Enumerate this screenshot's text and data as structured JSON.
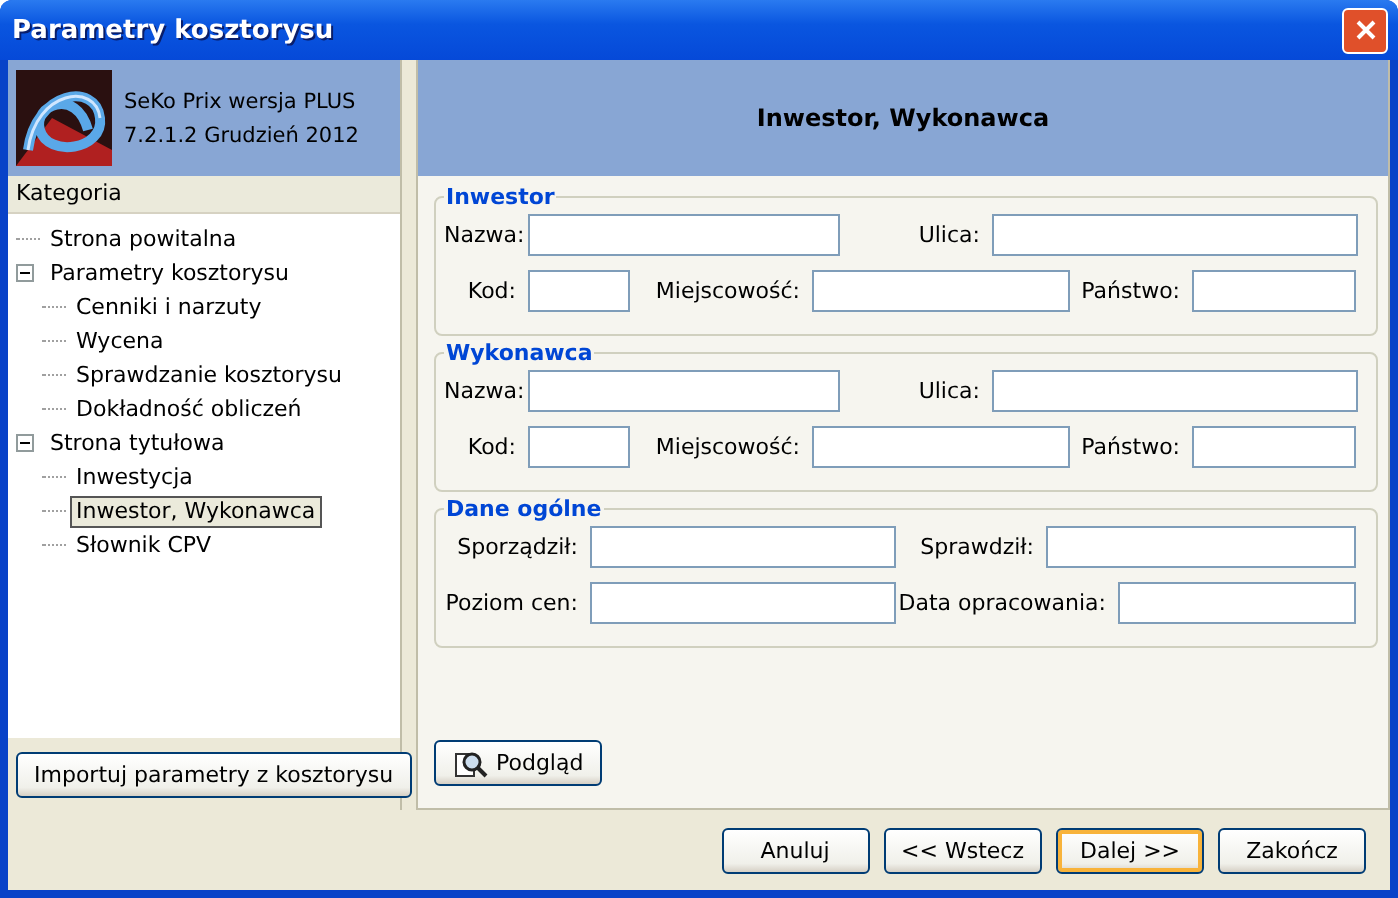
{
  "window": {
    "title": "Parametry kosztorysu"
  },
  "app_info": {
    "name": "SeKo Prix wersja PLUS",
    "version": "7.2.1.2 Grudzień 2012"
  },
  "tree": {
    "header": "Kategoria",
    "items": [
      {
        "label": "Strona powitalna",
        "selected": false
      },
      {
        "label": "Parametry kosztorysu",
        "selected": false,
        "expanded": true,
        "children": [
          {
            "label": "Cenniki i narzuty",
            "selected": false
          },
          {
            "label": "Wycena",
            "selected": false
          },
          {
            "label": "Sprawdzanie kosztorysu",
            "selected": false
          },
          {
            "label": "Dokładność obliczeń",
            "selected": false
          }
        ]
      },
      {
        "label": "Strona tytułowa",
        "selected": false,
        "expanded": true,
        "children": [
          {
            "label": "Inwestycja",
            "selected": false
          },
          {
            "label": "Inwestor, Wykonawca",
            "selected": true
          },
          {
            "label": "Słownik CPV",
            "selected": false
          }
        ]
      }
    ]
  },
  "import_button": "Importuj parametry z kosztorysu",
  "page_title": "Inwestor, Wykonawca",
  "groups": [
    {
      "title": "Inwestor",
      "kind": "address",
      "rows": [
        [
          {
            "label": "Nazwa:"
          },
          {
            "label": "Ulica:"
          }
        ],
        [
          {
            "label": "Kod:"
          },
          {
            "label": "Miejscowość:"
          },
          {
            "label": "Państwo:"
          }
        ]
      ]
    },
    {
      "title": "Wykonawca",
      "kind": "address",
      "rows": [
        [
          {
            "label": "Nazwa:"
          },
          {
            "label": "Ulica:"
          }
        ],
        [
          {
            "label": "Kod:"
          },
          {
            "label": "Miejscowość:"
          },
          {
            "label": "Państwo:"
          }
        ]
      ]
    },
    {
      "title": "Dane ogólne",
      "kind": "general",
      "rows": [
        [
          {
            "label": "Sporządził:"
          },
          {
            "label": "Sprawdził:"
          }
        ],
        [
          {
            "label": "Poziom cen:"
          },
          {
            "label": "Data opracowania:"
          }
        ]
      ]
    }
  ],
  "preview_button": "Podgląd",
  "buttons": [
    {
      "label": "Anuluj",
      "focused": false
    },
    {
      "label": "<< Wstecz",
      "focused": false
    },
    {
      "label": "Dalej >>",
      "focused": true
    },
    {
      "label": "Zakończ",
      "focused": false
    }
  ]
}
